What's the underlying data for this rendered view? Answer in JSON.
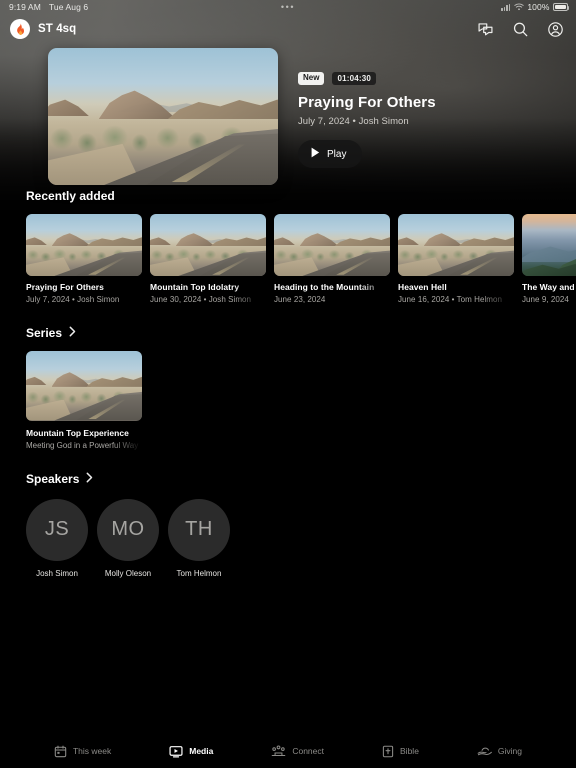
{
  "status_bar": {
    "time": "9:19 AM",
    "date": "Tue Aug 6",
    "dots": "•••",
    "battery_percent": "100%"
  },
  "header": {
    "brand": "ST 4sq",
    "logo_icon": "flame-icon",
    "actions": [
      {
        "name": "messages-icon",
        "label": "Messages"
      },
      {
        "name": "search-icon",
        "label": "Search"
      },
      {
        "name": "account-icon",
        "label": "Account"
      }
    ]
  },
  "hero": {
    "badge_new": "New",
    "duration": "01:04:30",
    "title": "Praying For Others",
    "subtitle": "July 7, 2024 • Josh Simon",
    "play_label": "Play",
    "thumbnail": "desert-road-photo"
  },
  "recently_added": {
    "heading": "Recently added",
    "items": [
      {
        "title": "Praying For Others",
        "meta": "July 7, 2024 • Josh Simon",
        "image": "desert-road-photo"
      },
      {
        "title": "Mountain Top Idolatry",
        "meta": "June 30, 2024 • Josh Simon",
        "image": "desert-road-photo"
      },
      {
        "title": "Heading to the Mountain",
        "meta": "June 23, 2024",
        "image": "desert-road-photo"
      },
      {
        "title": "Heaven Hell",
        "meta": "June 16, 2024 • Tom Helmon",
        "image": "desert-road-photo"
      },
      {
        "title": "The Way and The Truth",
        "meta": "June 9, 2024",
        "image": "mountain-vista-photo"
      }
    ]
  },
  "series": {
    "heading": "Series",
    "chevron_icon": "chevron-right-icon",
    "items": [
      {
        "title": "Mountain Top Experience",
        "subtitle": "Meeting God in a Powerful Way",
        "image": "desert-road-photo"
      }
    ]
  },
  "speakers": {
    "heading": "Speakers",
    "chevron_icon": "chevron-right-icon",
    "items": [
      {
        "initials": "JS",
        "name": "Josh Simon"
      },
      {
        "initials": "MO",
        "name": "Molly Oleson"
      },
      {
        "initials": "TH",
        "name": "Tom Helmon"
      }
    ]
  },
  "tabbar": {
    "tabs": [
      {
        "label": "This week",
        "icon": "calendar-icon",
        "active": false
      },
      {
        "label": "Media",
        "icon": "media-screen-icon",
        "active": true
      },
      {
        "label": "Connect",
        "icon": "people-icon",
        "active": false
      },
      {
        "label": "Bible",
        "icon": "bible-icon",
        "active": false
      },
      {
        "label": "Giving",
        "icon": "giving-hand-icon",
        "active": false
      }
    ]
  },
  "colors": {
    "accent_flame": "#f05a28",
    "background": "#000000",
    "header_wash": "#575651",
    "muted_text": "#a9a7a3"
  }
}
